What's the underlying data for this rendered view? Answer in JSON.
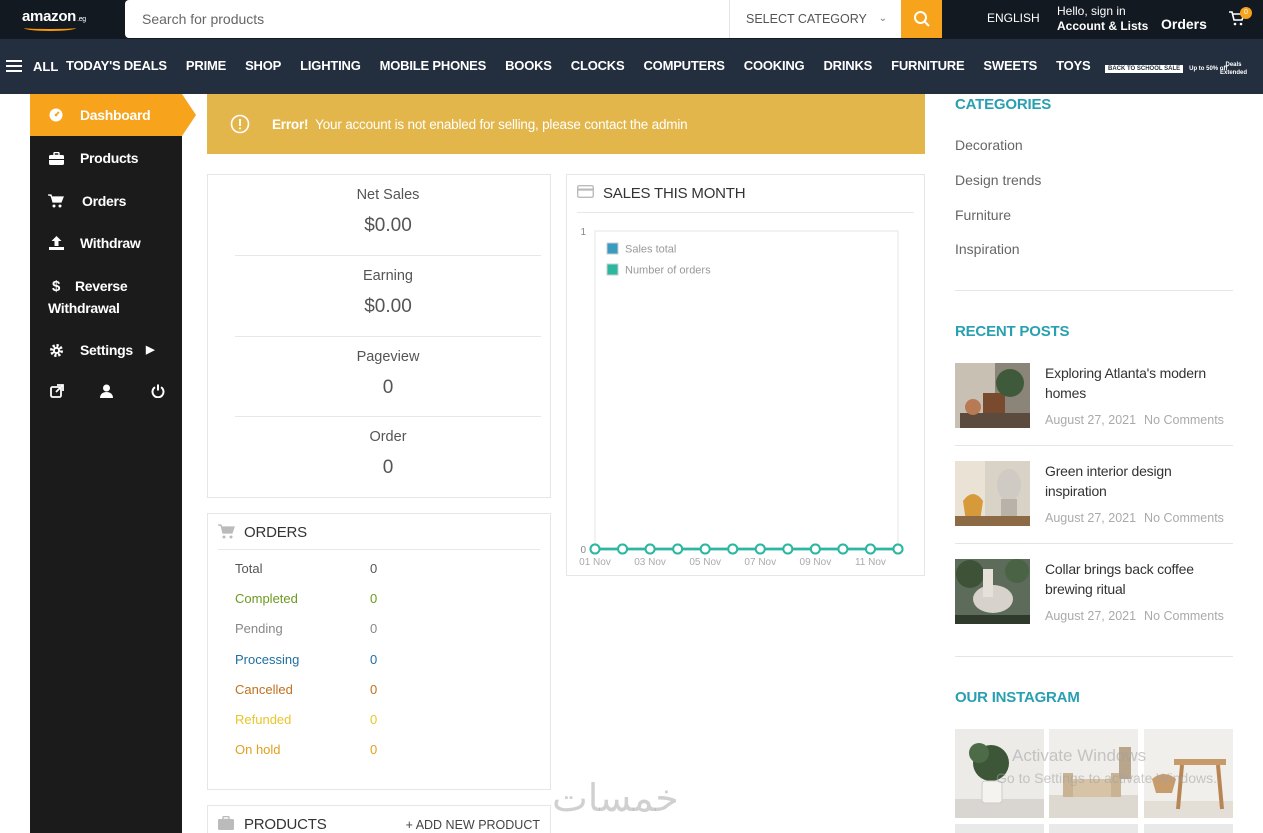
{
  "header": {
    "logo": "amazon",
    "logo_suffix": ".eg",
    "search_placeholder": "Search for products",
    "select_category": "SELECT CATEGORY",
    "language": "ENGLISH",
    "account_line1": "Hello, sign in",
    "account_line2": "Account & Lists",
    "orders": "Orders",
    "cart_count": "0"
  },
  "nav": {
    "all": "ALL",
    "links": [
      "TODAY'S DEALS",
      "PRIME",
      "SHOP",
      "LIGHTING",
      "MOBILE PHONES",
      "BOOKS",
      "CLOCKS",
      "COMPUTERS",
      "COOKING",
      "DRINKS",
      "FURNITURE",
      "SWEETS",
      "TOYS"
    ],
    "promo_tag": "BACK TO SCHOOL SALE",
    "promo_text": "Up to 50% off",
    "promo2_line1": "Deals",
    "promo2_line2": "Extended"
  },
  "sidebar": {
    "items": [
      {
        "label": "Dashboard",
        "icon": "dashboard-icon"
      },
      {
        "label": "Products",
        "icon": "briefcase-icon"
      },
      {
        "label": "Orders",
        "icon": "cart-icon"
      },
      {
        "label": "Withdraw",
        "icon": "upload-icon"
      },
      {
        "label": "Reverse",
        "label2": "Withdrawal",
        "icon": "dollar-icon"
      },
      {
        "label": "Settings",
        "icon": "gear-icon"
      }
    ]
  },
  "error": {
    "strong": "Error!",
    "message": "Your account is not enabled for selling, please contact the admin"
  },
  "stats": [
    {
      "label": "Net Sales",
      "value": "$0.00"
    },
    {
      "label": "Earning",
      "value": "$0.00"
    },
    {
      "label": "Pageview",
      "value": "0"
    },
    {
      "label": "Order",
      "value": "0"
    }
  ],
  "orders": {
    "title": "ORDERS",
    "rows": [
      {
        "label": "Total",
        "value": "0",
        "color": "#555555"
      },
      {
        "label": "Completed",
        "value": "0",
        "color": "#6b9a1f"
      },
      {
        "label": "Pending",
        "value": "0",
        "color": "#888888"
      },
      {
        "label": "Processing",
        "value": "0",
        "color": "#1f6fa0"
      },
      {
        "label": "Cancelled",
        "value": "0",
        "color": "#c0701f"
      },
      {
        "label": "Refunded",
        "value": "0",
        "color": "#e8c52b"
      },
      {
        "label": "On hold",
        "value": "0",
        "color": "#e0a020"
      }
    ]
  },
  "products": {
    "title": "PRODUCTS",
    "add_label": "+ ADD NEW PRODUCT"
  },
  "sales": {
    "title": "SALES THIS MONTH"
  },
  "chart_data": {
    "type": "line",
    "x": [
      "01 Nov",
      "02 Nov",
      "03 Nov",
      "04 Nov",
      "05 Nov",
      "06 Nov",
      "07 Nov",
      "08 Nov",
      "09 Nov",
      "10 Nov",
      "11 Nov",
      "12 Nov"
    ],
    "tick_labels": [
      "01 Nov",
      "03 Nov",
      "05 Nov",
      "07 Nov",
      "09 Nov",
      "11 Nov"
    ],
    "series": [
      {
        "name": "Sales total",
        "values": [
          0,
          0,
          0,
          0,
          0,
          0,
          0,
          0,
          0,
          0,
          0,
          0
        ],
        "color": "#3a9bc0"
      },
      {
        "name": "Number of orders",
        "values": [
          0,
          0,
          0,
          0,
          0,
          0,
          0,
          0,
          0,
          0,
          0,
          0
        ],
        "color": "#2bb8a0"
      }
    ],
    "ylim": [
      0,
      1
    ],
    "y_ticks": [
      "0",
      "1"
    ],
    "legend": "top-left"
  },
  "right": {
    "categories_title": "CATEGORIES",
    "categories": [
      "Decoration",
      "Design trends",
      "Furniture",
      "Inspiration"
    ],
    "recent_title": "RECENT POSTS",
    "posts": [
      {
        "title": "Exploring Atlanta's modern homes",
        "date": "August 27, 2021",
        "comments": "No Comments"
      },
      {
        "title": "Green interior design inspiration",
        "date": "August 27, 2021",
        "comments": "No Comments"
      },
      {
        "title": "Collar brings back coffee brewing ritual",
        "date": "August 27, 2021",
        "comments": "No Comments"
      }
    ],
    "instagram_title": "OUR INSTAGRAM"
  },
  "watermark": {
    "line1": "Activate Windows",
    "line2": "Go to Settings to activate Windows.",
    "brand": "خمسات"
  }
}
